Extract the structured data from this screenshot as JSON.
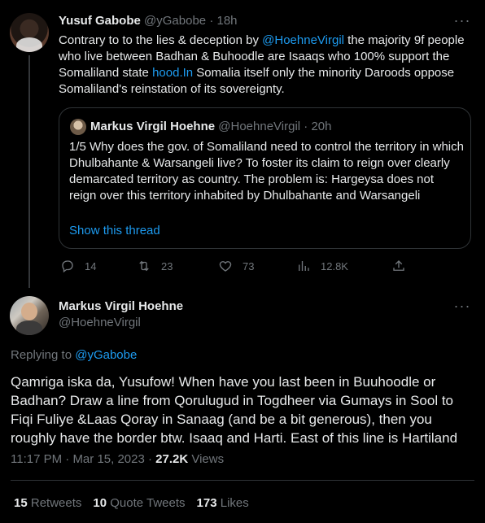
{
  "tweet1": {
    "author_name": "Yusuf Gabobe",
    "author_handle": "@yGabobe",
    "separator": "·",
    "time": "18h",
    "text_before_mention": "Contrary to to the lies & deception by ",
    "mention": "@HoehneVirgil",
    "text_after_mention": " the majority 9f people who live between Badhan & Buhoodle are Isaaqs who 100% support the Somaliland state ",
    "link": "hood.In",
    "text_end": " Somalia itself only the minority Daroods oppose Somaliland's reinstation of its sovereignty.",
    "quote": {
      "author_name": "Markus Virgil Hoehne",
      "author_handle": "@HoehneVirgil",
      "separator": "·",
      "time": "20h",
      "text": "1/5 Why does the gov. of Somaliland need to control the territory in which Dhulbahante & Warsangeli live? To foster its claim to reign over clearly demarcated territory as country. The problem is: Hargeysa does not reign over this territory inhabited by Dhulbahante and Warsangeli",
      "show_thread": "Show this thread"
    },
    "actions": {
      "replies": "14",
      "retweets": "23",
      "likes": "73",
      "views": "12.8K"
    }
  },
  "tweet2": {
    "author_name": "Markus Virgil Hoehne",
    "author_handle": "@HoehneVirgil",
    "replying_prefix": "Replying to ",
    "replying_handle": "@yGabobe",
    "text": "Qamriga iska da, Yusufow! When have you last been in Buuhoodle or Badhan? Draw a line from Qorulugud in Togdheer via Gumays in Sool to Fiqi Fuliye &Laas Qoray in Sanaag (and be a bit generous), then you roughly have the border btw. Isaaq and Harti. East of this line is Hartiland",
    "time": "11:17 PM",
    "meta_sep": " · ",
    "date": "Mar 15, 2023",
    "views_count": "27.2K",
    "views_label": " Views",
    "retweets_count": "15",
    "retweets_label": " Retweets",
    "quote_count": "10",
    "quote_label": " Quote Tweets",
    "likes_count": "173",
    "likes_label": " Likes"
  },
  "colors": {
    "background": "#000000",
    "text": "#e7e9ea",
    "secondary": "#71767b",
    "accent": "#1d9bf0",
    "border": "#2f3336"
  }
}
